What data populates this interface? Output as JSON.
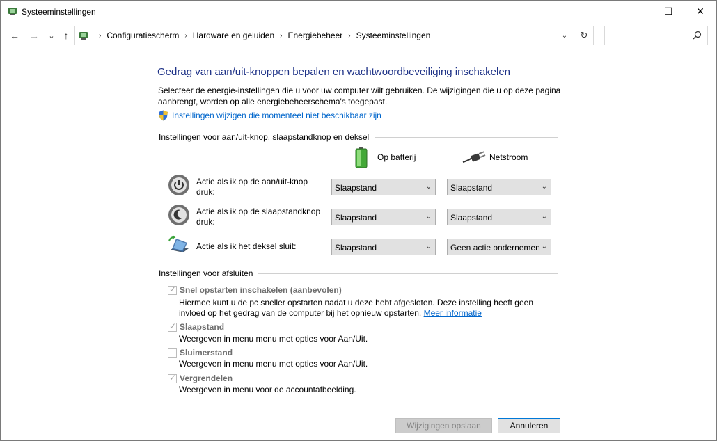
{
  "window": {
    "title": "Systeeminstellingen",
    "minimize_glyph": "—",
    "maximize_glyph": "☐",
    "close_glyph": "✕"
  },
  "nav": {
    "back_glyph": "←",
    "forward_glyph": "→",
    "recent_glyph": "⌄",
    "up_glyph": "↑"
  },
  "address": {
    "breadcrumbs": [
      "Configuratiescherm",
      "Hardware en geluiden",
      "Energiebeheer",
      "Systeeminstellingen"
    ],
    "separator": "›",
    "dropdown_glyph": "⌄",
    "refresh_glyph": "↻"
  },
  "search": {
    "placeholder": "",
    "icon": "search-icon"
  },
  "page": {
    "heading": "Gedrag van aan/uit-knoppen bepalen en wachtwoordbeveiliging inschakelen",
    "intro": "Selecteer de energie-instellingen die u voor uw computer wilt gebruiken. De wijzigingen die u op deze pagina aanbrengt, worden op alle energiebeheerschema's toegepast.",
    "admin_link": "Instellingen wijzigen die momenteel niet beschikbaar zijn"
  },
  "power_buttons": {
    "group_title": "Instellingen voor aan/uit-knop, slaapstandknop en deksel",
    "col_battery": "Op batterij",
    "col_ac": "Netstroom",
    "rows": [
      {
        "label": "Actie als ik op de aan/uit-knop druk:",
        "icon": "power-button-icon",
        "battery": "Slaapstand",
        "ac": "Slaapstand"
      },
      {
        "label": "Actie als ik op de slaapstandknop druk:",
        "icon": "sleep-button-icon",
        "battery": "Slaapstand",
        "ac": "Slaapstand"
      },
      {
        "label": "Actie als ik het deksel sluit:",
        "icon": "laptop-lid-icon",
        "battery": "Slaapstand",
        "ac": "Geen actie ondernemen"
      }
    ]
  },
  "shutdown": {
    "group_title": "Instellingen voor afsluiten",
    "items": [
      {
        "label": "Snel opstarten inschakelen (aanbevolen)",
        "checked": true,
        "desc": "Hiermee kunt u de pc sneller opstarten nadat u deze hebt afgesloten. Deze instelling heeft geen invloed op het gedrag van de computer bij het opnieuw opstarten.",
        "link": "Meer informatie"
      },
      {
        "label": "Slaapstand",
        "checked": true,
        "desc": "Weergeven in menu menu met opties voor Aan/Uit."
      },
      {
        "label": "Sluimerstand",
        "checked": false,
        "desc": "Weergeven in menu menu met opties voor Aan/Uit."
      },
      {
        "label": "Vergrendelen",
        "checked": true,
        "desc": "Weergeven in menu voor de accountafbeelding."
      }
    ]
  },
  "footer": {
    "save_label": "Wijzigingen opslaan",
    "cancel_label": "Annuleren"
  },
  "colors": {
    "heading": "#1e3287",
    "link": "#0066cc",
    "accent": "#0078d7"
  }
}
